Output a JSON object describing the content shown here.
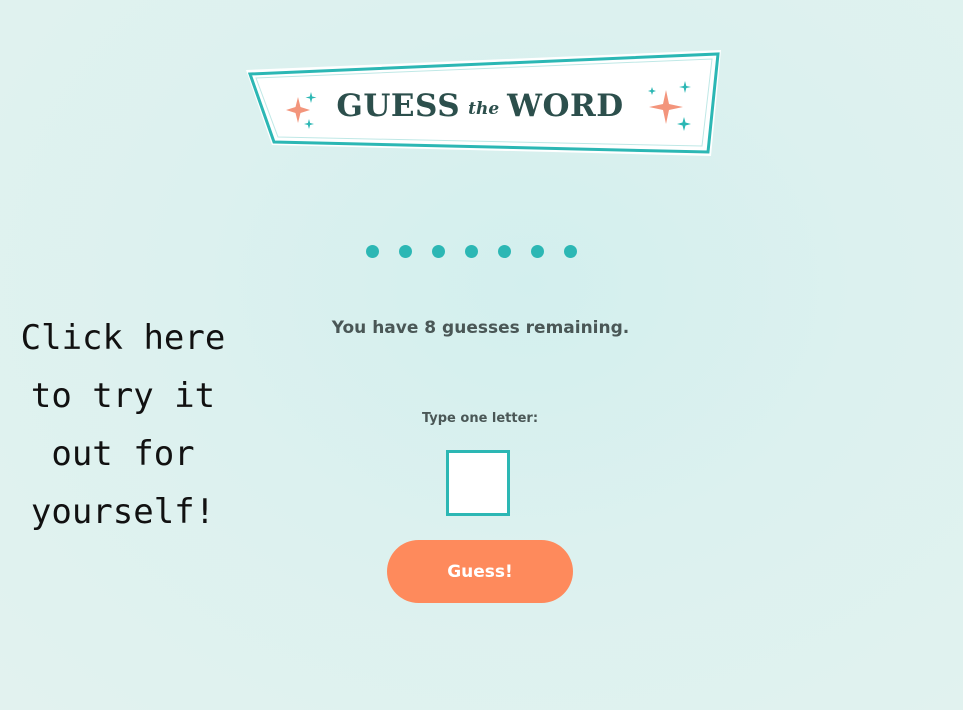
{
  "logo": {
    "guess": "GUESS",
    "the": "the",
    "word": "WORD"
  },
  "word": {
    "letters": [
      "●",
      "●",
      "●",
      "●",
      "●",
      "●",
      "●"
    ]
  },
  "status": {
    "remaining_text": "You have 8 guesses remaining."
  },
  "form": {
    "letter_label": "Type one letter:",
    "letter_value": "",
    "guess_button_label": "Guess!"
  },
  "callout": {
    "lines": [
      "Click here",
      "to try it",
      "out for",
      "yourself!"
    ]
  },
  "colors": {
    "accent": "#2cb7b4",
    "button": "#fe8a5c",
    "sparkle": "#f3957c",
    "logo_text": "#2c4f4c"
  }
}
